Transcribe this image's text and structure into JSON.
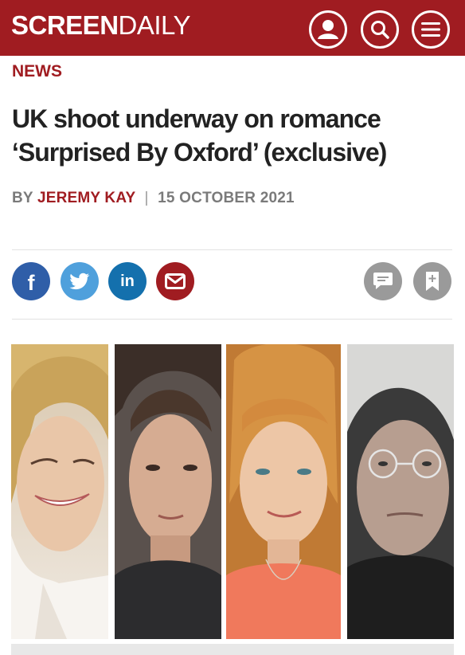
{
  "header": {
    "logo_bold": "SCREEN",
    "logo_light": "DAILY",
    "brand_color": "#a01c21",
    "icons": [
      "user-icon",
      "search-icon",
      "menu-icon"
    ]
  },
  "article": {
    "section": "NEWS",
    "headline": "UK shoot underway on romance ‘Surprised By Oxford’ (exclusive)",
    "byline_prefix": "BY",
    "author": "JEREMY KAY",
    "separator": "|",
    "date": "15 OCTOBER 2021"
  },
  "share": {
    "facebook_label": "f",
    "linkedin_label": "in",
    "icons": [
      "facebook-icon",
      "twitter-icon",
      "linkedin-icon",
      "email-icon",
      "comment-icon",
      "bookmark-icon"
    ],
    "colors": {
      "facebook": "#2f5ea8",
      "twitter": "#4fa0dc",
      "linkedin": "#1470ad",
      "email": "#a01c21",
      "neutral": "#9a9a9a"
    }
  }
}
